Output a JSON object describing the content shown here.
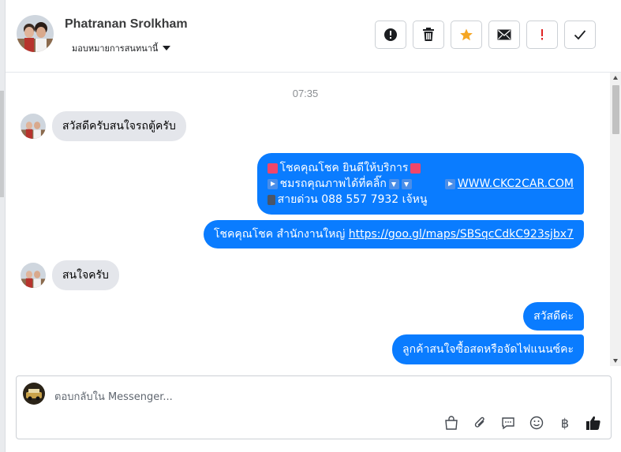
{
  "contact": {
    "name": "Phatranan Srolkham",
    "assign_label": "มอบหมายการสนทนานี้"
  },
  "actions": [
    {
      "icon": "alert-circle-icon",
      "name": "spam-button"
    },
    {
      "icon": "trash-icon",
      "name": "delete-button"
    },
    {
      "icon": "star-icon",
      "name": "star-button",
      "color": "#f5a623"
    },
    {
      "icon": "envelope-icon",
      "name": "mark-unread-button"
    },
    {
      "icon": "exclamation-icon",
      "name": "follow-up-button",
      "color": "#e02424"
    },
    {
      "icon": "checkmark-icon",
      "name": "mark-done-button"
    }
  ],
  "chat": {
    "timestamp": "07:35",
    "incoming_1": "สวัสดีครับสนใจรถตู้ครับ",
    "outgoing_1": {
      "line1": "โชคคุณโชค ยินดีให้บริการ",
      "line2": "ชมรถคุณภาพได้ที่คลิ๊ก",
      "link": "WWW.CKC2CAR.COM",
      "line3": "สายด่วน 088 557 7932 เจ้หนู"
    },
    "outgoing_2": {
      "text": "โชคคุณโชค สำนักงานใหญ่",
      "link": "https://goo.gl/maps/SBSqcCdkC923sjbx7"
    },
    "incoming_2": "สนใจครับ",
    "outgoing_3": "สวัสดีค่ะ",
    "outgoing_4": "ลูกค้าสนใจซื้อสดหรือจัดไฟแนนซ์คะ"
  },
  "composer": {
    "placeholder": "ตอบกลับใน Messenger..."
  },
  "toolbar": {
    "icons": [
      "shop-bag-icon",
      "paperclip-icon",
      "saved-replies-icon",
      "emoji-icon",
      "baht-payment-icon",
      "thumbs-up-icon"
    ],
    "baht_symbol": "฿"
  },
  "colors": {
    "outgoing_bubble": "#0a7cff",
    "incoming_bubble": "#e4e6eb"
  }
}
